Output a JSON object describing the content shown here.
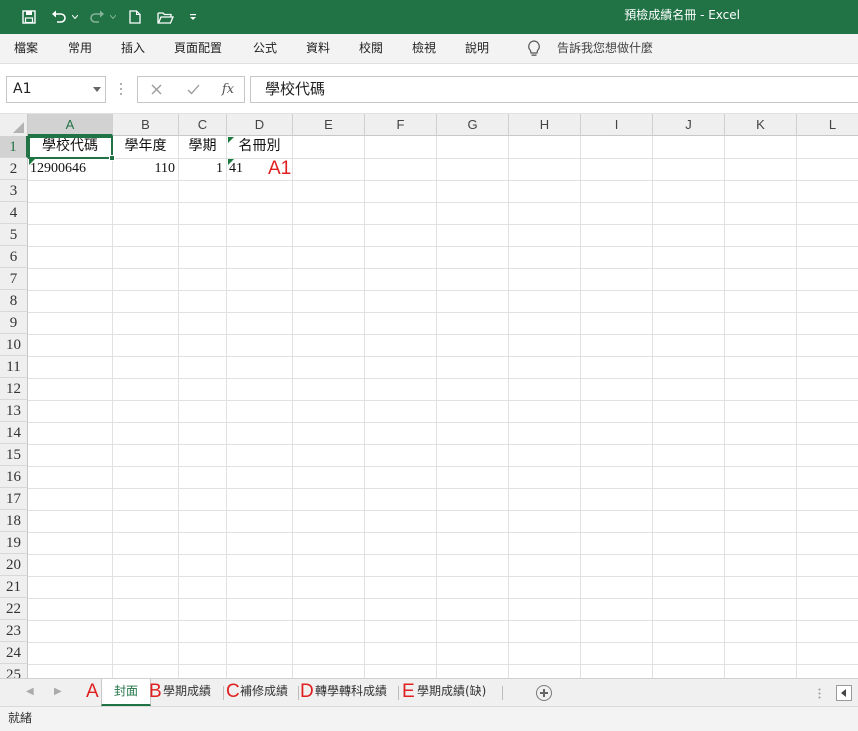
{
  "window": {
    "title": "預檢成績名冊  -  Excel"
  },
  "ribbon": {
    "tabs": [
      "檔案",
      "常用",
      "插入",
      "頁面配置",
      "公式",
      "資料",
      "校閱",
      "檢視",
      "說明"
    ],
    "tell_me": "告訴我您想做什麼"
  },
  "formula_bar": {
    "name_box": "A1",
    "fx": "fx",
    "content": "學校代碼"
  },
  "grid": {
    "columns": [
      "A",
      "B",
      "C",
      "D",
      "E",
      "F",
      "G",
      "H",
      "I",
      "J",
      "K",
      "L"
    ],
    "rows": [
      "1",
      "2",
      "3",
      "4",
      "5",
      "6",
      "7",
      "8",
      "9",
      "10",
      "11",
      "12",
      "13",
      "14",
      "15",
      "16",
      "17",
      "18",
      "19",
      "20",
      "21",
      "22",
      "23",
      "24",
      "25"
    ],
    "selected_cell": "A1",
    "cells": {
      "A1": "學校代碼",
      "B1": "學年度",
      "C1": "學期",
      "D1": "名冊別",
      "A2": "12900646",
      "B2": "110",
      "C2": "1",
      "D2": "41"
    },
    "annotation": "A1",
    "annotation_color": "#e02020"
  },
  "sheets": {
    "letters": [
      "A",
      "B",
      "C",
      "D",
      "E"
    ],
    "tabs": [
      "封面",
      "學期成績",
      "補修成績",
      "轉學轉科成績",
      "學期成績(缺)"
    ],
    "active_index": 0
  },
  "status": {
    "text": "就緒"
  },
  "colors": {
    "accent": "#217346",
    "annotation": "#e02020"
  }
}
